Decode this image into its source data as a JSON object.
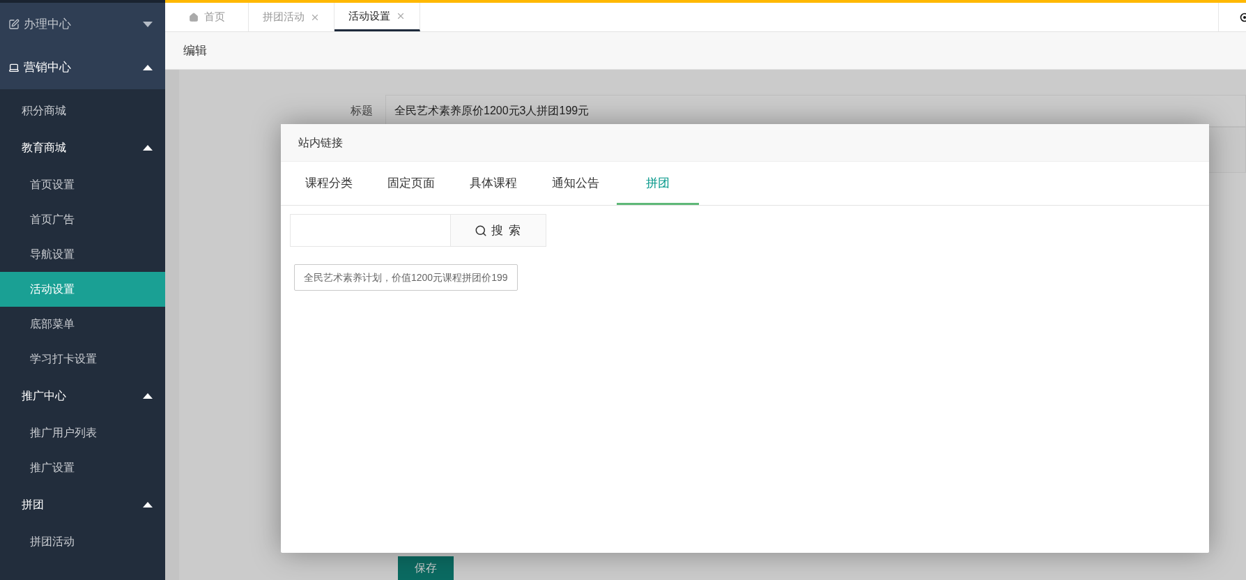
{
  "sidebar": {
    "groups": [
      {
        "label": "办理中心",
        "expanded": false
      },
      {
        "label": "营销中心",
        "expanded": true,
        "children": [
          {
            "kind": "link",
            "label": "积分商城",
            "selected": false
          },
          {
            "kind": "section",
            "label": "教育商城",
            "expanded": true,
            "children": [
              {
                "label": "首页设置",
                "selected": false
              },
              {
                "label": "首页广告",
                "selected": false
              },
              {
                "label": "导航设置",
                "selected": false
              },
              {
                "label": "活动设置",
                "selected": true
              },
              {
                "label": "底部菜单",
                "selected": false
              },
              {
                "label": "学习打卡设置",
                "selected": false
              }
            ]
          },
          {
            "kind": "section",
            "label": "推广中心",
            "expanded": true,
            "children": [
              {
                "label": "推广用户列表",
                "selected": false
              },
              {
                "label": "推广设置",
                "selected": false
              }
            ]
          },
          {
            "kind": "section",
            "label": "拼团",
            "expanded": true,
            "children": [
              {
                "label": "拼团活动",
                "selected": false
              }
            ]
          }
        ]
      }
    ]
  },
  "tabs": [
    {
      "label": "首页",
      "selected": false,
      "closable": false
    },
    {
      "label": "拼团活动",
      "selected": false,
      "closable": true
    },
    {
      "label": "活动设置",
      "selected": true,
      "closable": true
    }
  ],
  "breadcrumb": "编辑",
  "form": {
    "fields": [
      {
        "label": "标题",
        "value": "全民艺术素养原价1200元3人拼团199元"
      }
    ],
    "save_button": "保存"
  },
  "modal": {
    "title": "站内链接",
    "tabs": [
      {
        "label": "课程分类",
        "selected": false
      },
      {
        "label": "固定页面",
        "selected": false
      },
      {
        "label": "具体课程",
        "selected": false
      },
      {
        "label": "通知公告",
        "selected": false
      },
      {
        "label": "拼团",
        "selected": true
      }
    ],
    "search_button": "搜 索",
    "results": [
      "全民艺术素养计划，价值1200元课程拼团价199"
    ]
  }
}
